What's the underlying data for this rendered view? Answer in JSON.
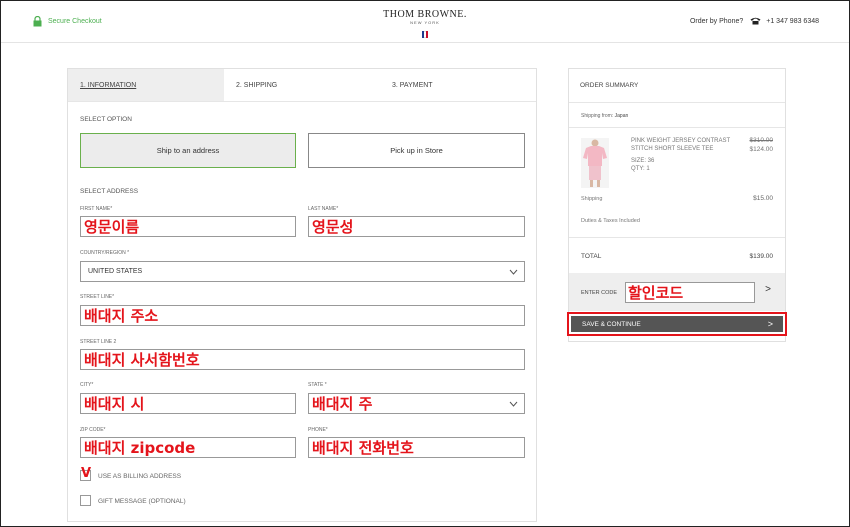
{
  "header": {
    "secure_text": "Secure Checkout",
    "brand_name": "THOM BROWNE.",
    "brand_sub": "NEW YORK",
    "order_label": "Order by Phone?",
    "phone": "+1 347 983 6348",
    "icons": {
      "lock": "lock-icon",
      "phone": "phone-icon"
    },
    "colors": {
      "secure": "#4caf50",
      "flag": [
        "#1f3b8f",
        "#ffffff",
        "#c8102e"
      ]
    }
  },
  "steps": [
    {
      "label": "1. INFORMATION",
      "active": true
    },
    {
      "label": "2. SHIPPING",
      "active": false
    },
    {
      "label": "3. PAYMENT",
      "active": false
    }
  ],
  "form": {
    "select_option_label": "SELECT OPTION",
    "options": [
      {
        "label": "Ship to an address",
        "selected": true
      },
      {
        "label": "Pick up in Store",
        "selected": false
      }
    ],
    "select_address_label": "SELECT ADDRESS",
    "fields": {
      "first_name": {
        "label": "FIRST NAME*",
        "value": "영문이름"
      },
      "last_name": {
        "label": "LAST NAME*",
        "value": "영문성"
      },
      "country": {
        "label": "COUNTRY/REGION *",
        "value": "UNITED STATES"
      },
      "street_line": {
        "label": "STREET LINE*",
        "value": "배대지 주소"
      },
      "street_line2": {
        "label": "STREET LINE 2",
        "value": "배대지 사서함번호"
      },
      "city": {
        "label": "CITY*",
        "value": "배대지 시"
      },
      "state": {
        "label": "STATE *",
        "value": "배대지 주"
      },
      "zip": {
        "label": "ZIP CODE*",
        "value": "배대지 zipcode"
      },
      "phone": {
        "label": "PHONE*",
        "value": "배대지 전화번호"
      }
    },
    "billing": {
      "label": "USE AS BILLING ADDRESS",
      "checked": true,
      "mark": "V"
    },
    "gift": {
      "label": "GIFT MESSAGE (OPTIONAL)",
      "checked": false
    },
    "annotation_color": "#e4141b"
  },
  "summary": {
    "title": "ORDER SUMMARY",
    "shipping_from_label": "Shipping from:",
    "shipping_from_value": "Japan",
    "product": {
      "name": "PINK WEIGHT JERSEY CONTRAST STITCH SHORT SLEEVE TEE",
      "price_old": "$310.00",
      "price_new": "$124.00",
      "size": "SIZE: 36",
      "qty": "QTY: 1"
    },
    "shipping_label": "Shipping",
    "shipping_value": "$15.00",
    "duties_label": "Duties & Taxes Included",
    "total_label": "TOTAL",
    "total_value": "$139.00",
    "code_label": "ENTER CODE",
    "code_value": "할인코드",
    "code_arrow": ">",
    "save_label": "SAVE & CONTINUE",
    "save_arrow": ">"
  }
}
